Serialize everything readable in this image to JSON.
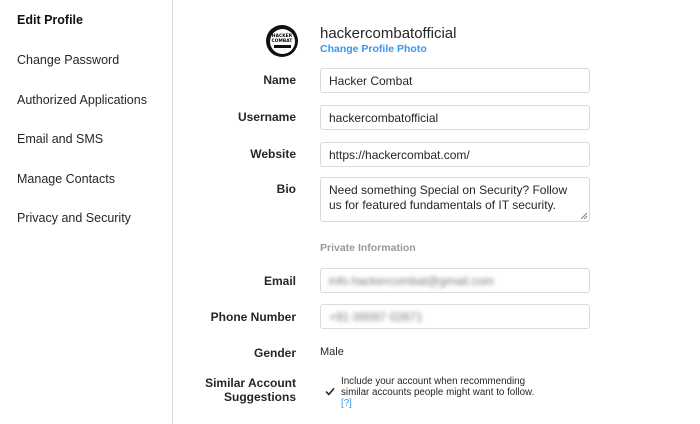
{
  "sidebar": {
    "items": [
      {
        "label": "Edit Profile",
        "active": true
      },
      {
        "label": "Change Password"
      },
      {
        "label": "Authorized Applications"
      },
      {
        "label": "Email and SMS"
      },
      {
        "label": "Manage Contacts"
      },
      {
        "label": "Privacy and Security"
      }
    ]
  },
  "profile": {
    "avatar_text_line1": "HACKER",
    "avatar_text_line2": "COMBAT",
    "username": "hackercombatofficial",
    "change_photo_label": "Change Profile Photo"
  },
  "form": {
    "name_label": "Name",
    "name_value": "Hacker Combat",
    "username_label": "Username",
    "username_value": "hackercombatofficial",
    "website_label": "Website",
    "website_value": "https://hackercombat.com/",
    "bio_label": "Bio",
    "bio_value": "Need something Special on Security? Follow us for featured fundamentals of IT security.",
    "private_info_title": "Private Information",
    "email_label": "Email",
    "email_value": "info.hackercombat@gmail.com",
    "phone_label": "Phone Number",
    "phone_value": "+91 00097 02871",
    "gender_label": "Gender",
    "gender_value": "Male",
    "similar_label_line1": "Similar Account",
    "similar_label_line2": "Suggestions",
    "similar_text": "Include your account when recommending similar accounts people might want to follow.",
    "similar_help": "[?]",
    "similar_checked": true
  },
  "colors": {
    "accent": "#3897f0",
    "border": "#dbdbdb",
    "muted": "#999999"
  }
}
